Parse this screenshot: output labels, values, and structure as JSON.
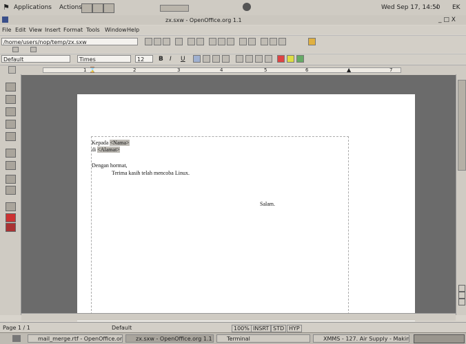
{
  "top_panel": {
    "applications": "Applications",
    "actions": "Actions",
    "clock": "Wed Sep 17, 14:50",
    "tray_label": "EK"
  },
  "window": {
    "title": "zx.sxw - OpenOffice.org 1.1",
    "controls": "_ □ X"
  },
  "menu": [
    "File",
    "Edit",
    "View",
    "Insert",
    "Format",
    "Tools",
    "Window",
    "Help"
  ],
  "urlbar": {
    "value": "/home/users/nop/temp/zx.sxw"
  },
  "formatbar": {
    "style": "Default",
    "font": "Times",
    "size": "12",
    "bold": "B",
    "italic": "I",
    "underline": "U"
  },
  "ruler": {
    "marks": [
      "1",
      "2",
      "3",
      "4",
      "5",
      "6",
      "7"
    ]
  },
  "document": {
    "line1_prefix": "Kepada ",
    "line1_field": "<Nama>",
    "line2_prefix": "di ",
    "line2_field": "<Alamat>",
    "greeting": "Dengan hormat,",
    "body": "Terima kasih telah mencoba Linux.",
    "closing": "Salam."
  },
  "status": {
    "page": "Page 1 / 1",
    "style": "Default",
    "zoom": "100%",
    "insert": "INSRT",
    "std": "STD",
    "hyp": "HYP"
  },
  "taskbar": {
    "items": [
      "mail_merge.rtf - OpenOffice.org 1",
      "zx.sxw - OpenOffice.org 1.1",
      "Terminal",
      "XMMS - 127. Air Supply - Making"
    ]
  }
}
